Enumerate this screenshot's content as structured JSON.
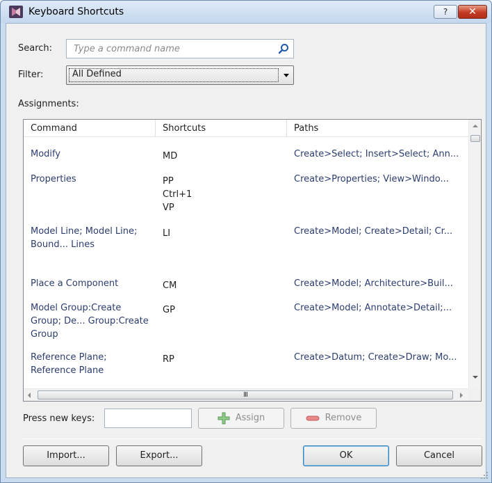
{
  "window": {
    "title": "Keyboard Shortcuts",
    "help_label": "?",
    "close_label": "✕"
  },
  "search": {
    "label": "Search:",
    "placeholder": "Type a command name"
  },
  "filter": {
    "label": "Filter:",
    "selected": "All Defined"
  },
  "assignments": {
    "label": "Assignments:",
    "columns": [
      "Command",
      "Shortcuts",
      "Paths"
    ],
    "rows": [
      {
        "command": "Modify",
        "shortcuts": [
          "MD"
        ],
        "paths": "Create>Select; Insert>Select; Ann..."
      },
      {
        "command": "Properties",
        "shortcuts": [
          "PP",
          "Ctrl+1",
          "VP"
        ],
        "paths": "Create>Properties; View>Windo..."
      },
      {
        "command": "Model Line; Model Line; Bound... Lines",
        "shortcuts": [
          "LI"
        ],
        "paths": "Create>Model; Create>Detail; Cr..."
      },
      {
        "command": "Place a Component",
        "shortcuts": [
          "CM"
        ],
        "paths": "Create>Model; Architecture>Buil..."
      },
      {
        "command": "Model Group:Create Group; De... Group:Create Group",
        "shortcuts": [
          "GP"
        ],
        "paths": "Create>Model; Annotate>Detail;..."
      },
      {
        "command": "Reference Plane; Reference Plane",
        "shortcuts": [
          "RP"
        ],
        "paths": "Create>Datum; Create>Draw; Mo..."
      }
    ]
  },
  "hscroll_grip": "III",
  "press_keys": {
    "label": "Press new keys:",
    "value": ""
  },
  "buttons": {
    "assign": "Assign",
    "remove": "Remove",
    "import": "Import...",
    "export": "Export...",
    "ok": "OK",
    "cancel": "Cancel"
  },
  "colors": {
    "command_text": "#2b3d6e",
    "assign_icon": "#4caf50",
    "remove_icon": "#e05050",
    "close_button": "#c23a22"
  }
}
